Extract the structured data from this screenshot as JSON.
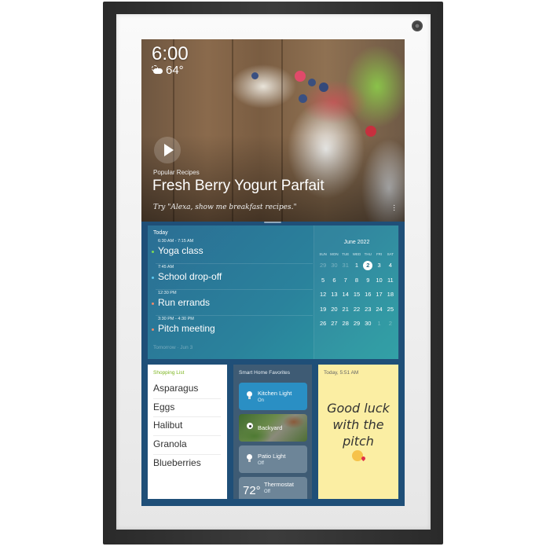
{
  "device": {
    "camera": "camera-lens"
  },
  "hero": {
    "time": "6:00",
    "weather_icon": "partly-cloudy-icon",
    "temperature": "64°",
    "kicker": "Popular Recipes",
    "title": "Fresh Berry Yogurt Parfait",
    "hint": "Try \"Alexa, show me breakfast recipes.\"",
    "more_icon": "⋮"
  },
  "agenda": {
    "header": "Today",
    "events": [
      {
        "time": "6:30 AM - 7:15 AM",
        "title": "Yoga class",
        "dot_color": "#7ed957"
      },
      {
        "time": "7:45 AM",
        "title": "School drop-off",
        "dot_color": "#5ec8f0"
      },
      {
        "time": "12:30 PM",
        "title": "Run errands",
        "dot_color": "#f08a6a"
      },
      {
        "time": "3:30 PM - 4:30 PM",
        "title": "Pitch meeting",
        "dot_color": "#f08a6a"
      }
    ],
    "footer": "Tomorrow · Jun 3"
  },
  "calendar": {
    "title": "June 2022",
    "weekdays": [
      "SUN",
      "MON",
      "TUE",
      "WED",
      "THU",
      "FRI",
      "SAT"
    ],
    "days": [
      {
        "d": "29",
        "muted": true
      },
      {
        "d": "30",
        "muted": true
      },
      {
        "d": "31",
        "muted": true
      },
      {
        "d": "1"
      },
      {
        "d": "2",
        "today": true
      },
      {
        "d": "3"
      },
      {
        "d": "4"
      },
      {
        "d": "5"
      },
      {
        "d": "6"
      },
      {
        "d": "7"
      },
      {
        "d": "8"
      },
      {
        "d": "9"
      },
      {
        "d": "10"
      },
      {
        "d": "11"
      },
      {
        "d": "12"
      },
      {
        "d": "13"
      },
      {
        "d": "14"
      },
      {
        "d": "15"
      },
      {
        "d": "16"
      },
      {
        "d": "17"
      },
      {
        "d": "18"
      },
      {
        "d": "19"
      },
      {
        "d": "20"
      },
      {
        "d": "21"
      },
      {
        "d": "22"
      },
      {
        "d": "23"
      },
      {
        "d": "24"
      },
      {
        "d": "25"
      },
      {
        "d": "26"
      },
      {
        "d": "27"
      },
      {
        "d": "28"
      },
      {
        "d": "29"
      },
      {
        "d": "30"
      },
      {
        "d": "1",
        "muted": true
      },
      {
        "d": "2",
        "muted": true
      }
    ]
  },
  "shopping": {
    "title": "Shopping List",
    "items": [
      "Asparagus",
      "Eggs",
      "Halibut",
      "Granola",
      "Blueberries"
    ]
  },
  "smart_home": {
    "title": "Smart Home Favorites",
    "tiles": [
      {
        "name": "Kitchen Light",
        "state": "On",
        "icon": "lightbulb-icon",
        "color": "#2a8fc4"
      },
      {
        "name": "Backyard",
        "state": "",
        "icon": "camera-icon"
      },
      {
        "name": "Patio Light",
        "state": "Off",
        "icon": "lightbulb-icon",
        "color": "#6d8598"
      },
      {
        "name": "Thermostat",
        "state": "Off",
        "value": "72°",
        "icon": "thermostat-icon",
        "color": "#6d8598"
      }
    ]
  },
  "note": {
    "timestamp": "Today, 5:51 AM",
    "lines": [
      "Good luck",
      "with the",
      "pitch"
    ],
    "emoji": "kissing-face-emoji"
  }
}
